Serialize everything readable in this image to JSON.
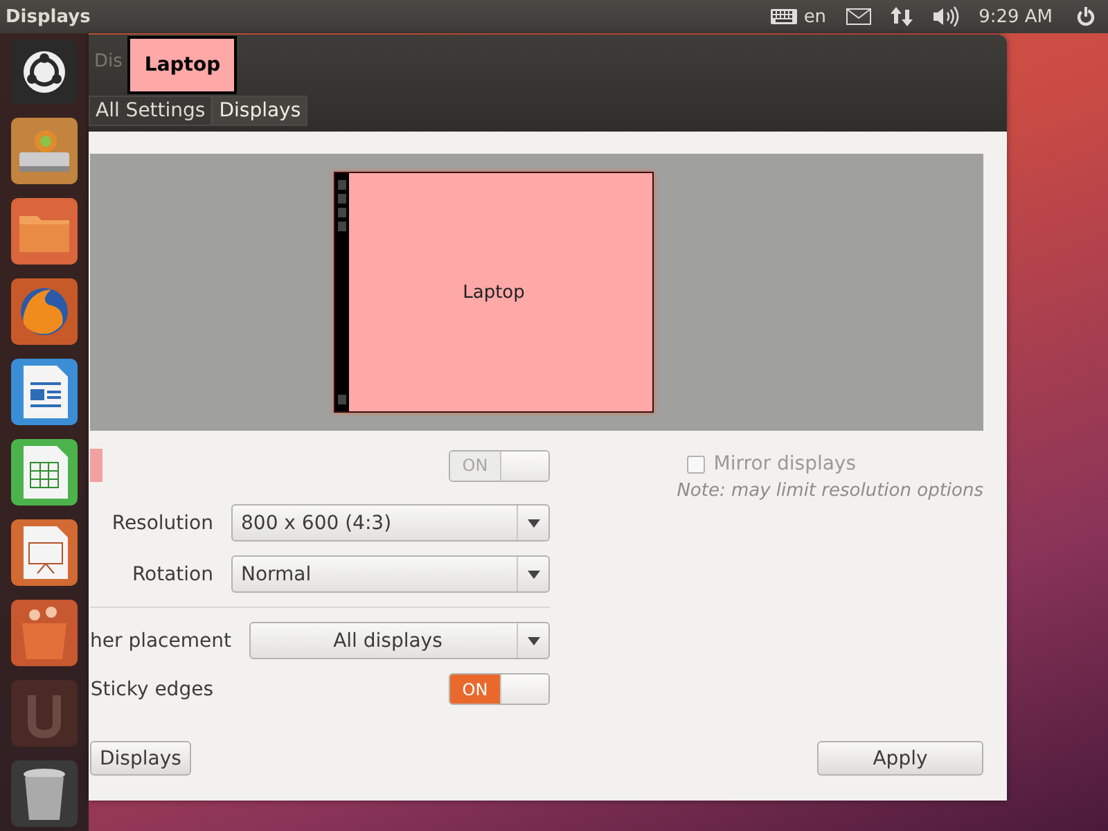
{
  "top_panel": {
    "title": "Displays",
    "keyboard_layout": "en",
    "clock": "9:29 AM"
  },
  "window": {
    "title": "Dis",
    "breadcrumb": [
      {
        "label": "All Settings",
        "selected": false
      },
      {
        "label": "Displays",
        "selected": true
      }
    ]
  },
  "display_label": "Laptop",
  "monitors": [
    {
      "name": "Laptop"
    }
  ],
  "display_switch": {
    "label": "ON",
    "on": true,
    "disabled": true
  },
  "mirror": {
    "label": "Mirror displays",
    "checked": false,
    "disabled": true,
    "note": "Note: may limit resolution options"
  },
  "fields": [
    {
      "label": "Resolution",
      "value": "800 x 600 (4:3)"
    },
    {
      "label": "Rotation",
      "value": "Normal"
    }
  ],
  "launcher_placement": {
    "label": "her placement",
    "value": "All displays"
  },
  "sticky_edges": {
    "label": "Sticky edges",
    "switch": "ON",
    "on": true,
    "disabled": false
  },
  "buttons": [
    {
      "label": "Displays"
    },
    {
      "label": "Apply"
    }
  ]
}
